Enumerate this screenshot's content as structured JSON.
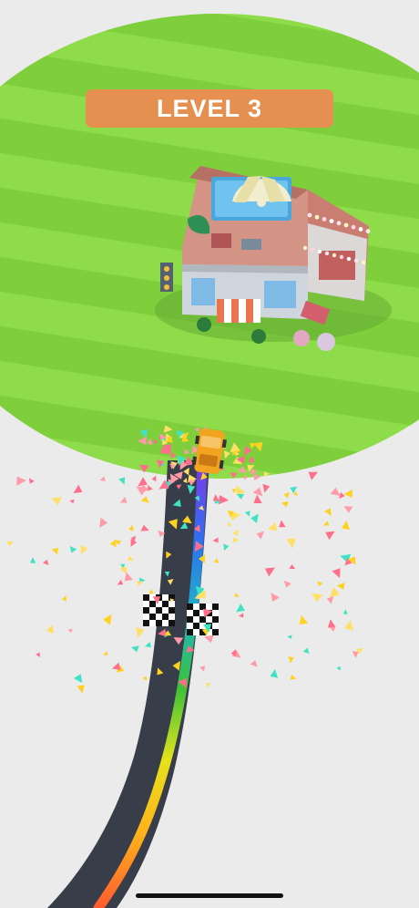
{
  "hud": {
    "level_label": "LEVEL 3"
  },
  "colors": {
    "grass_light": "#8fdc4a",
    "grass_dark": "#7fce3c",
    "road": "#383d4a",
    "banner": "#e58f50",
    "car": "#f2a320",
    "background": "#ebebeb"
  },
  "trail_gradient": [
    "#ff5b2e",
    "#ffb11c",
    "#e6e21a",
    "#39c23a",
    "#1fb3c9",
    "#2f6ff0",
    "#7b3be8"
  ],
  "confetti_colors": [
    "#ff6f8c",
    "#ffd21f",
    "#3fe3c3",
    "#ff9aa8",
    "#ffe066"
  ]
}
